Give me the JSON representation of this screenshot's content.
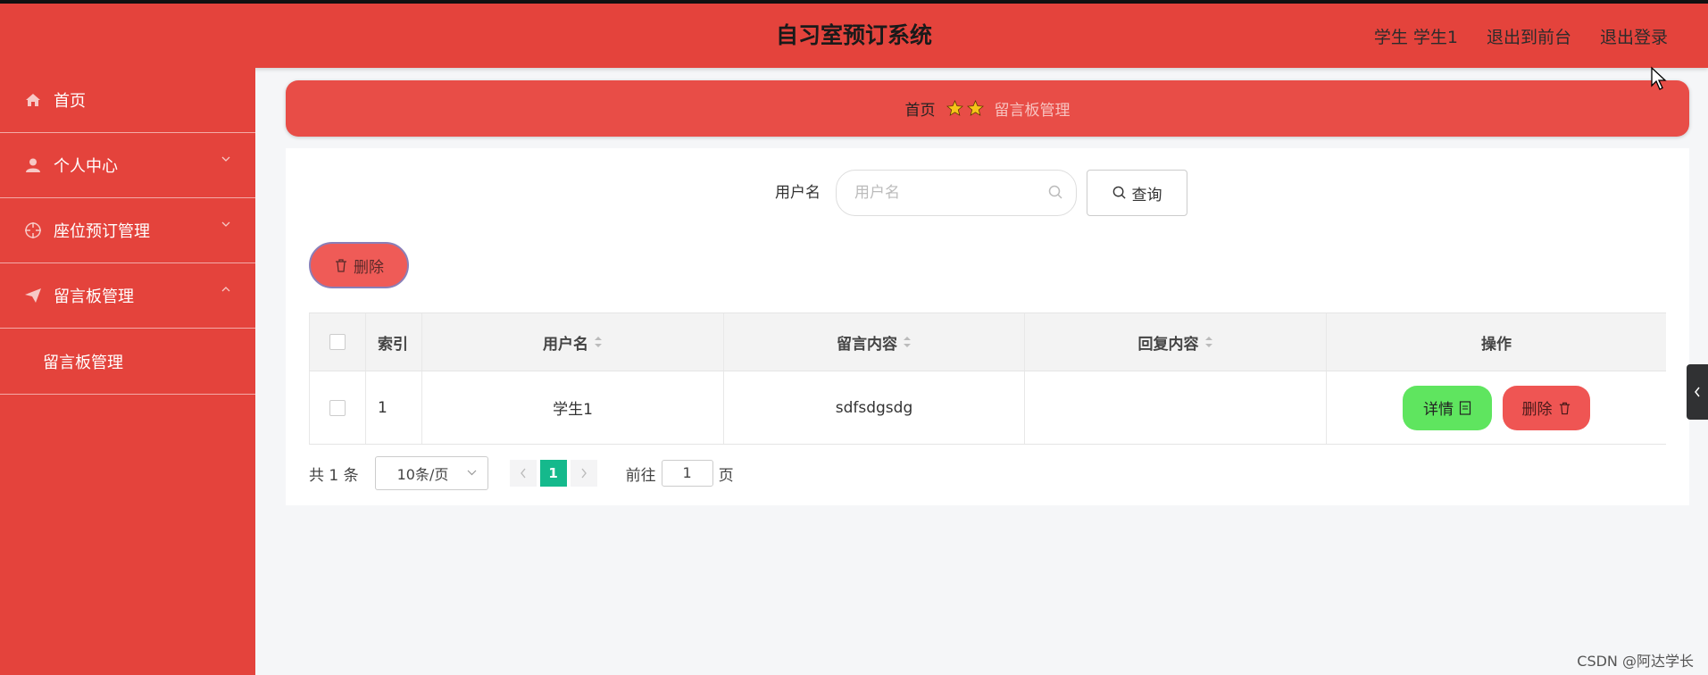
{
  "header": {
    "title": "自习室预订系统",
    "nav": [
      "学生 学生1",
      "退出到前台",
      "退出登录"
    ]
  },
  "sidebar": {
    "items": [
      {
        "label": "首页",
        "icon": "home-icon"
      },
      {
        "label": "个人中心",
        "icon": "user-icon"
      },
      {
        "label": "座位预订管理",
        "icon": "target-icon"
      },
      {
        "label": "留言板管理",
        "icon": "paper-plane-icon"
      }
    ],
    "submenu": [
      "留言板管理"
    ]
  },
  "breadcrumb": {
    "home": "首页",
    "current": "留言板管理"
  },
  "search": {
    "label": "用户名",
    "placeholder": "用户名",
    "button": "查询"
  },
  "actions": {
    "batch_delete": "删除"
  },
  "table": {
    "headers": [
      "索引",
      "用户名",
      "留言内容",
      "回复内容",
      "操作"
    ],
    "rows": [
      {
        "index": "1",
        "username": "学生1",
        "message": "sdfsdgsdg",
        "reply": ""
      }
    ],
    "row_buttons": {
      "detail": "详情",
      "delete": "删除"
    }
  },
  "pagination": {
    "total": "共 1 条",
    "page_size": "10条/页",
    "current": "1",
    "goto_label": "前往",
    "goto_value": "1",
    "page_suffix": "页"
  },
  "watermark": "CSDN @阿达学长",
  "colors": {
    "primary": "#e4433c",
    "success": "#5fe55f",
    "danger": "#ef5553",
    "pager_active": "#15b98c"
  }
}
